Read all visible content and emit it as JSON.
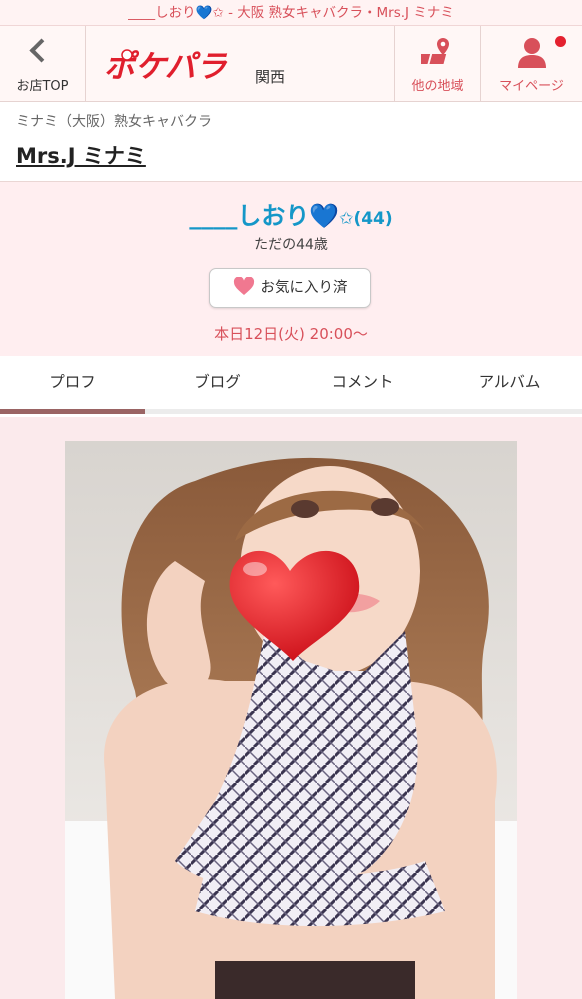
{
  "top_title": "____しおり💙✩ - 大阪 熟女キャバクラ・Mrs.J ミナミ",
  "header": {
    "back_label": "お店TOP",
    "logo_text": "ポケパラ",
    "region": "関西",
    "other_area_label": "他の地域",
    "mypage_label": "マイページ"
  },
  "shop": {
    "category": "ミナミ（大阪）熟女キャバクラ",
    "name": "Mrs.J ミナミ"
  },
  "profile": {
    "name": "____しおり💙",
    "star_age": "✩(44)",
    "tagline": "ただの44歳",
    "favorite_label": "お気に入り済",
    "schedule": "本日12日(火) 20:00〜"
  },
  "tabs": [
    {
      "label": "プロフ",
      "active": true
    },
    {
      "label": "ブログ",
      "active": false
    },
    {
      "label": "コメント",
      "active": false
    },
    {
      "label": "アルバム",
      "active": false
    }
  ],
  "colors": {
    "accent_red": "#d8505a",
    "name_blue": "#1597c8",
    "profile_bg": "#ffeef0",
    "tab_indicator": "#9a6464"
  }
}
